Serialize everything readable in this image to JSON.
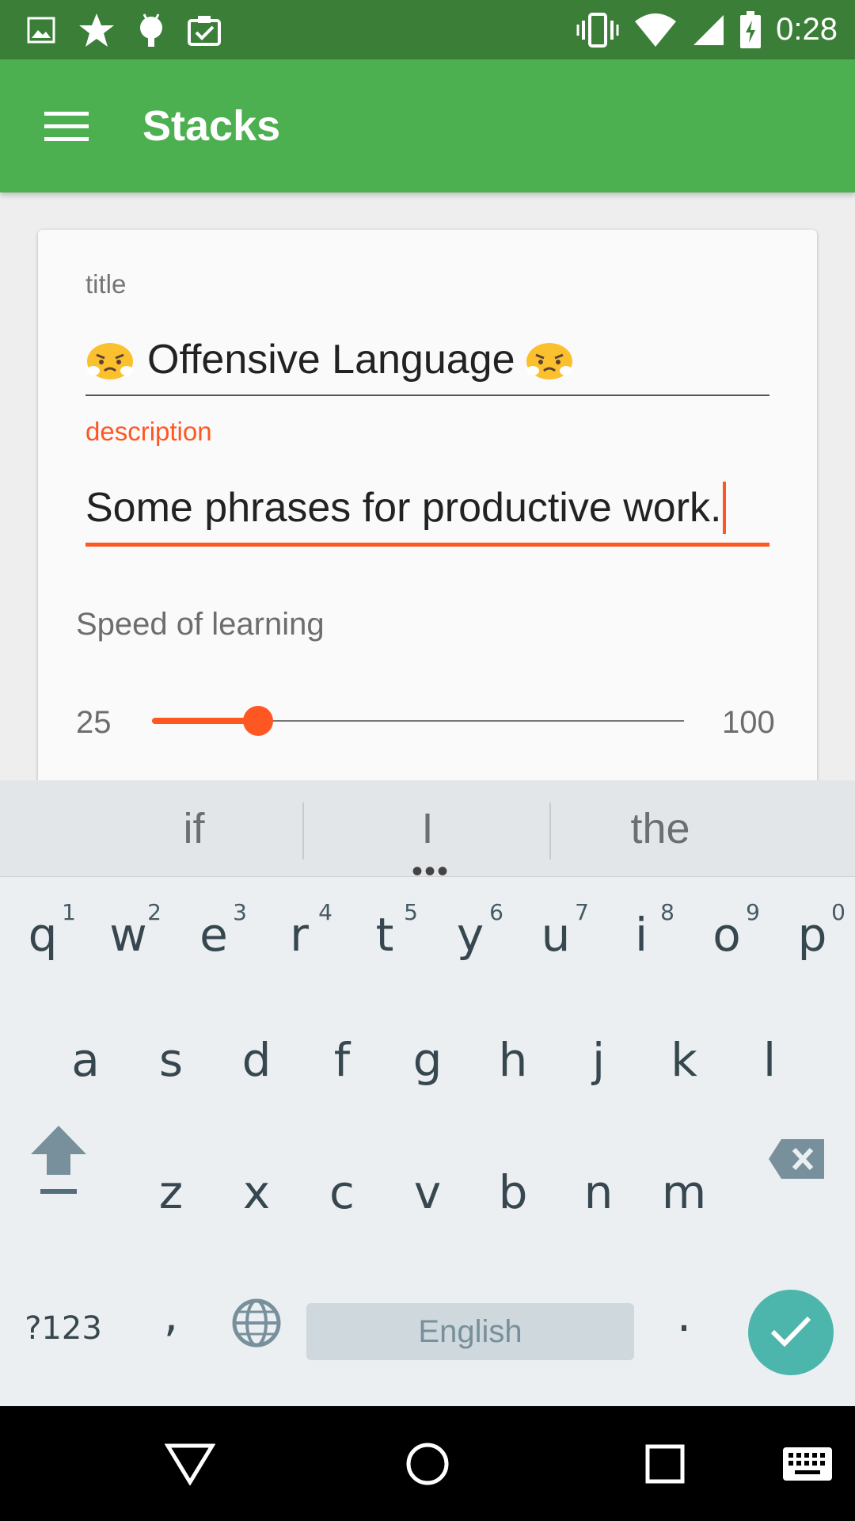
{
  "status_bar": {
    "time": "0:28",
    "left_icons": [
      "image-icon",
      "star-icon",
      "android-icon",
      "clipboard-check-icon"
    ],
    "right_icons": [
      "vibrate-icon",
      "wifi-icon",
      "signal-icon",
      "battery-charging-icon"
    ]
  },
  "app_bar": {
    "title": "Stacks",
    "menu_icon": "menu-icon",
    "color": "#4caf50"
  },
  "form": {
    "title_label": "title",
    "title_value": "Offensive Language",
    "title_emoji": "face-with-steam-icon",
    "description_label": "description",
    "description_value": "Some phrases for productive work.",
    "accent_color": "#ff5722"
  },
  "speed": {
    "label": "Speed of learning",
    "min_label": "25",
    "max_label": "100",
    "level_fraction": 0.2
  },
  "keyboard": {
    "suggestions": [
      "if",
      "I",
      "the"
    ],
    "row1": [
      {
        "key": "q",
        "hint": "1"
      },
      {
        "key": "w",
        "hint": "2"
      },
      {
        "key": "e",
        "hint": "3"
      },
      {
        "key": "r",
        "hint": "4"
      },
      {
        "key": "t",
        "hint": "5"
      },
      {
        "key": "y",
        "hint": "6"
      },
      {
        "key": "u",
        "hint": "7"
      },
      {
        "key": "i",
        "hint": "8"
      },
      {
        "key": "o",
        "hint": "9"
      },
      {
        "key": "p",
        "hint": "0"
      }
    ],
    "row2": [
      "a",
      "s",
      "d",
      "f",
      "g",
      "h",
      "j",
      "k",
      "l"
    ],
    "row3": [
      "z",
      "x",
      "c",
      "v",
      "b",
      "n",
      "m"
    ],
    "symbols_key": "?123",
    "comma_key": ",",
    "period_key": ".",
    "space_label": "English",
    "enter_color": "#4db6ac"
  },
  "nav_bar": {
    "icons": [
      "back-icon",
      "home-icon",
      "recents-icon",
      "keyboard-icon"
    ]
  }
}
